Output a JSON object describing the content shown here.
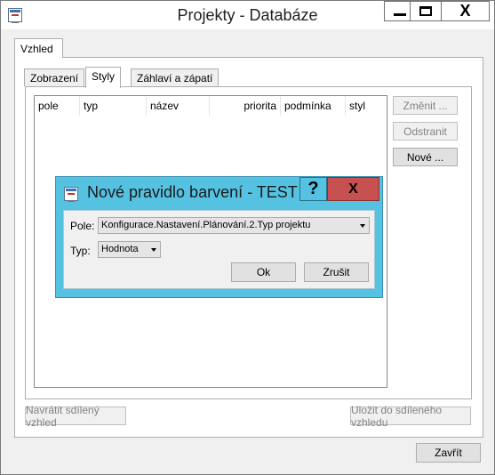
{
  "window": {
    "title": "Projekty - Databáze",
    "close_glyph": "X"
  },
  "outer_tab": {
    "label": "Vzhled"
  },
  "tabs": [
    {
      "label": "Zobrazení"
    },
    {
      "label": "Styly"
    },
    {
      "label": "Záhlaví a zápatí"
    }
  ],
  "table": {
    "columns": [
      "pole",
      "typ",
      "název",
      "priorita",
      "podmínka",
      "styl"
    ]
  },
  "side_buttons": {
    "edit": "Změnit ...",
    "remove": "Odstranit",
    "new": "Nové ..."
  },
  "bottom_buttons": {
    "restore_shared": "Navrátit sdílený vzhled",
    "save_shared": "Uložit do sdíleného vzhledu",
    "close": "Zavřít"
  },
  "dialog": {
    "title": "Nové pravidlo barvení - TEST",
    "help_glyph": "?",
    "close_glyph": "X",
    "field_label": "Pole:",
    "field_value": "Konfigurace.Nastavení.Plánování.2.Typ projektu",
    "type_label": "Typ:",
    "type_value": "Hodnota",
    "ok_label": "Ok",
    "cancel_label": "Zrušit"
  }
}
